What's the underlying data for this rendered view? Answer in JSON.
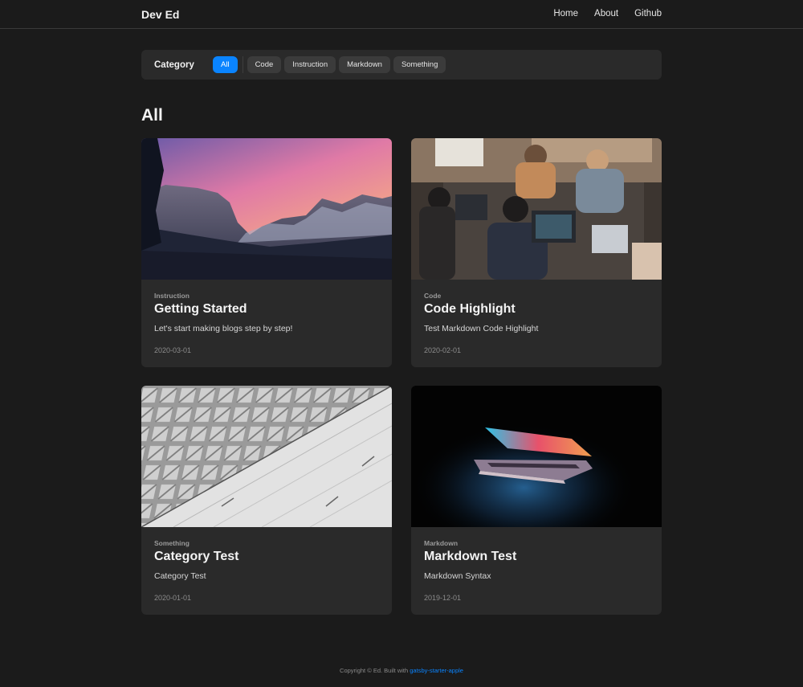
{
  "header": {
    "brand": "Dev Ed",
    "nav": [
      {
        "label": "Home"
      },
      {
        "label": "About"
      },
      {
        "label": "Github"
      }
    ]
  },
  "category_bar": {
    "title": "Category",
    "chips": [
      "All",
      "Code",
      "Instruction",
      "Markdown",
      "Something"
    ],
    "active": "All"
  },
  "section": {
    "title": "All"
  },
  "posts": [
    {
      "category": "Instruction",
      "title": "Getting Started",
      "description": "Let's start making blogs step by step!",
      "date": "2020-03-01"
    },
    {
      "category": "Code",
      "title": "Code Highlight",
      "description": "Test Markdown Code Highlight",
      "date": "2020-02-01"
    },
    {
      "category": "Something",
      "title": "Category Test",
      "description": "Category Test",
      "date": "2020-01-01"
    },
    {
      "category": "Markdown",
      "title": "Markdown Test",
      "description": "Markdown Syntax",
      "date": "2019-12-01"
    }
  ],
  "footer": {
    "text": "Copyright © Ed. Built with ",
    "link_label": "gatsby-starter-apple"
  },
  "colors": {
    "background": "#1b1b1b",
    "card": "#2a2a2a",
    "accent": "#0a84ff"
  }
}
